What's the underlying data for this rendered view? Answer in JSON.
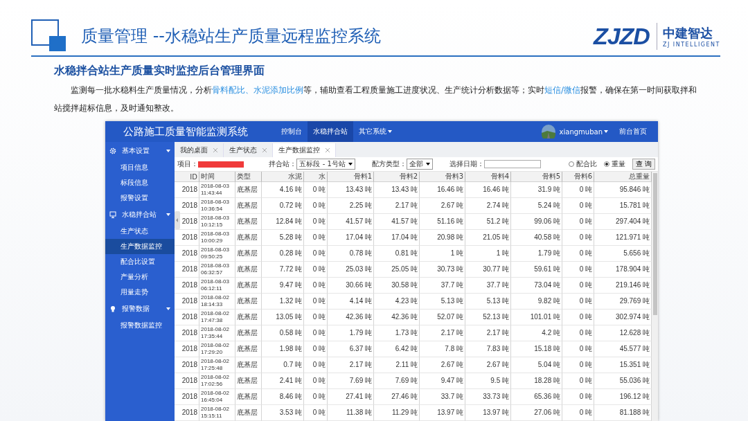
{
  "slide": {
    "title": "质量管理 --水稳站生产质量远程监控系统",
    "logo": {
      "mark": "ZJZD",
      "name": "中建智达",
      "tagline": "ZJ INTELLIGENT"
    },
    "subtitle": "水稳拌合站生产质量实时监控后台管理界面",
    "paragraph": [
      {
        "text": "监测每一批水稳料生产质量情况，分析",
        "highlight": false
      },
      {
        "text": "骨料配比、水泥添加比例",
        "highlight": true
      },
      {
        "text": "等，辅助查看工程质量施工进度状况、生产统计分析数据等；实时",
        "highlight": false
      },
      {
        "text": "短信/微信",
        "highlight": true
      },
      {
        "text": "报警，确保在第一时间获取拌和站搅拌超标信息，及时通知整改。",
        "highlight": false
      }
    ]
  },
  "app": {
    "title": "公路施工质量智能监测系统",
    "nav": [
      {
        "label": "控制台",
        "selected": false,
        "dropdown": false
      },
      {
        "label": "水稳拌合站",
        "selected": true,
        "dropdown": false
      },
      {
        "label": "其它系统",
        "selected": false,
        "dropdown": true
      }
    ],
    "user": "xiangmuban",
    "home_link": "前台首页",
    "sidebar": [
      {
        "label": "基本设置",
        "kind": "gear",
        "expanded": true,
        "children": [
          {
            "label": "项目信息",
            "selected": false
          },
          {
            "label": "标段信息",
            "selected": false
          },
          {
            "label": "报警设置",
            "selected": false
          }
        ]
      },
      {
        "label": "水稳拌合站",
        "kind": "monitor",
        "expanded": true,
        "children": [
          {
            "label": "生产状态",
            "selected": false
          },
          {
            "label": "生产数据监控",
            "selected": true
          },
          {
            "label": "配合比设置",
            "selected": false
          },
          {
            "label": "产量分析",
            "selected": false
          },
          {
            "label": "用量走势",
            "selected": false
          }
        ]
      },
      {
        "label": "报警数据",
        "kind": "bulb",
        "expanded": true,
        "children": [
          {
            "label": "报警数据监控",
            "selected": false
          }
        ]
      }
    ],
    "tabs": [
      {
        "label": "我的桌面",
        "selected": false
      },
      {
        "label": "生产状态",
        "selected": false
      },
      {
        "label": "生产数据监控",
        "selected": true
      }
    ],
    "filters": {
      "project_label": "项目：",
      "station_label": "拌合站：",
      "station_value": "五标段 - 1号站",
      "formula_label": "配方类型：",
      "formula_value": "全部",
      "date_label": "选择日期：",
      "radios": [
        {
          "label": "配合比",
          "selected": false
        },
        {
          "label": "重量",
          "selected": true
        }
      ],
      "query_button": "查 询"
    },
    "table": {
      "columns": [
        "ID",
        "时间",
        "类型",
        "水泥",
        "水",
        "骨料1",
        "骨料2",
        "骨料3",
        "骨料4",
        "骨料5",
        "骨料6",
        "总重量"
      ],
      "rows": [
        [
          "2018",
          "2018-08-03 11:43:44",
          "底基层",
          "4.16 吨",
          "0 吨",
          "13.43 吨",
          "13.43 吨",
          "16.46 吨",
          "16.46 吨",
          "31.9 吨",
          "0 吨",
          "95.846 吨"
        ],
        [
          "2018",
          "2018-08-03 10:36:54",
          "底基层",
          "0.72 吨",
          "0 吨",
          "2.25 吨",
          "2.17 吨",
          "2.67 吨",
          "2.74 吨",
          "5.24 吨",
          "0 吨",
          "15.781 吨"
        ],
        [
          "2018",
          "2018-08-03 10:12:15",
          "底基层",
          "12.84 吨",
          "0 吨",
          "41.57 吨",
          "41.57 吨",
          "51.16 吨",
          "51.2 吨",
          "99.06 吨",
          "0 吨",
          "297.404 吨"
        ],
        [
          "2018",
          "2018-08-03 10:00:29",
          "底基层",
          "5.28 吨",
          "0 吨",
          "17.04 吨",
          "17.04 吨",
          "20.98 吨",
          "21.05 吨",
          "40.58 吨",
          "0 吨",
          "121.971 吨"
        ],
        [
          "2018",
          "2018-08-03 09:50:25",
          "底基层",
          "0.28 吨",
          "0 吨",
          "0.78 吨",
          "0.81 吨",
          "1 吨",
          "1 吨",
          "1.79 吨",
          "0 吨",
          "5.656 吨"
        ],
        [
          "2018",
          "2018-08-03 06:32:57",
          "底基层",
          "7.72 吨",
          "0 吨",
          "25.03 吨",
          "25.05 吨",
          "30.73 吨",
          "30.77 吨",
          "59.61 吨",
          "0 吨",
          "178.904 吨"
        ],
        [
          "2018",
          "2018-08-03 06:12:11",
          "底基层",
          "9.47 吨",
          "0 吨",
          "30.66 吨",
          "30.58 吨",
          "37.7 吨",
          "37.7 吨",
          "73.04 吨",
          "0 吨",
          "219.146 吨"
        ],
        [
          "2018",
          "2018-08-02 18:14:33",
          "底基层",
          "1.32 吨",
          "0 吨",
          "4.14 吨",
          "4.23 吨",
          "5.13 吨",
          "5.13 吨",
          "9.82 吨",
          "0 吨",
          "29.769 吨"
        ],
        [
          "2018",
          "2018-08-02 17:47:38",
          "底基层",
          "13.05 吨",
          "0 吨",
          "42.36 吨",
          "42.36 吨",
          "52.07 吨",
          "52.13 吨",
          "101.01 吨",
          "0 吨",
          "302.974 吨"
        ],
        [
          "2018",
          "2018-08-02 17:35:44",
          "底基层",
          "0.58 吨",
          "0 吨",
          "1.79 吨",
          "1.73 吨",
          "2.17 吨",
          "2.17 吨",
          "4.2 吨",
          "0 吨",
          "12.628 吨"
        ],
        [
          "2018",
          "2018-08-02 17:29:20",
          "底基层",
          "1.98 吨",
          "0 吨",
          "6.37 吨",
          "6.42 吨",
          "7.8 吨",
          "7.83 吨",
          "15.18 吨",
          "0 吨",
          "45.577 吨"
        ],
        [
          "2018",
          "2018-08-02 17:25:48",
          "底基层",
          "0.7 吨",
          "0 吨",
          "2.17 吨",
          "2.11 吨",
          "2.67 吨",
          "2.67 吨",
          "5.04 吨",
          "0 吨",
          "15.351 吨"
        ],
        [
          "2018",
          "2018-08-02 17:02:56",
          "底基层",
          "2.41 吨",
          "0 吨",
          "7.69 吨",
          "7.69 吨",
          "9.47 吨",
          "9.5 吨",
          "18.28 吨",
          "0 吨",
          "55.036 吨"
        ],
        [
          "2018",
          "2018-08-02 16:45:04",
          "底基层",
          "8.46 吨",
          "0 吨",
          "27.41 吨",
          "27.46 吨",
          "33.7 吨",
          "33.73 吨",
          "65.36 吨",
          "0 吨",
          "196.12 吨"
        ],
        [
          "2018",
          "2018-08-02 15:15:11",
          "底基层",
          "3.53 吨",
          "0 吨",
          "11.38 吨",
          "11.29 吨",
          "13.97 吨",
          "13.97 吨",
          "27.06 吨",
          "0 吨",
          "81.188 吨"
        ]
      ]
    }
  }
}
